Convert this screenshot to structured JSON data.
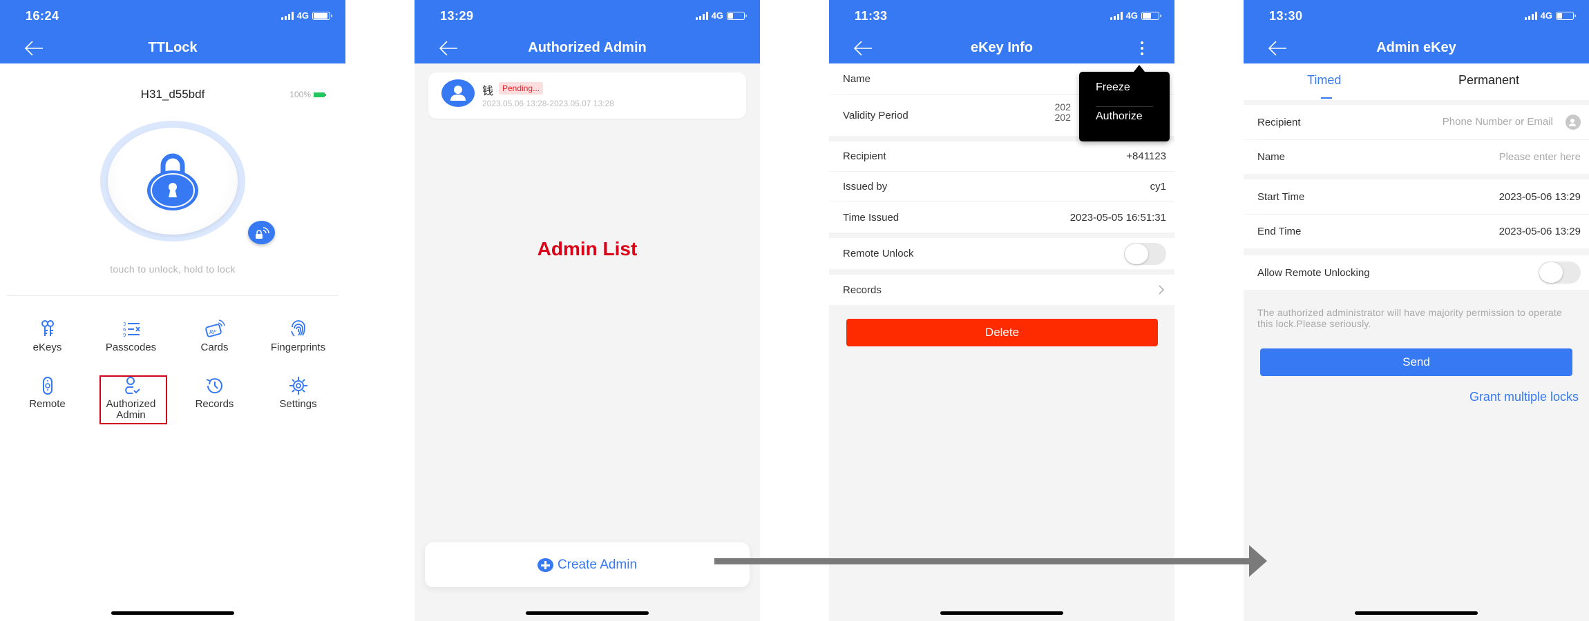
{
  "theme": {
    "primary": "#3679f3",
    "danger": "#fe2a00",
    "annotation": "#d90018",
    "arrow": "#7a7a7a"
  },
  "screen1": {
    "status": {
      "time": "16:24",
      "network": "4G",
      "battery_level": 1.0
    },
    "nav": {
      "title": "TTLock",
      "back_icon": "arrow-left-icon"
    },
    "lock_name": "H31_d55bdf",
    "battery_percent": "100%",
    "hint": "touch to unlock, hold to lock",
    "menu": [
      {
        "label": "eKeys",
        "icon": "ekeys-icon"
      },
      {
        "label": "Passcodes",
        "icon": "passcodes-icon"
      },
      {
        "label": "Cards",
        "icon": "rf-card-icon"
      },
      {
        "label": "Fingerprints",
        "icon": "fingerprint-icon"
      },
      {
        "label": "Remote",
        "icon": "remote-icon"
      },
      {
        "label": "Authorized Admin",
        "label_line1": "Authorized",
        "label_line2": "Admin",
        "icon": "authorized-admin-icon",
        "highlighted": true
      },
      {
        "label": "Records",
        "icon": "history-icon"
      },
      {
        "label": "Settings",
        "icon": "gear-icon"
      }
    ]
  },
  "screen2": {
    "status": {
      "time": "13:29",
      "network": "4G",
      "battery_level": 0.35
    },
    "nav": {
      "title": "Authorized Admin"
    },
    "admins": [
      {
        "name": "钱",
        "status": "Pending...",
        "period": "2023.05.06 13:28-2023.05.07 13:28"
      }
    ],
    "annotation": "Admin List",
    "create_button": "Create Admin"
  },
  "screen3": {
    "status": {
      "time": "11:33",
      "network": "4G",
      "battery_level": 0.6
    },
    "nav": {
      "title": "eKey Info"
    },
    "rows": {
      "name_label": "Name",
      "validity_label": "Validity Period",
      "validity_value_line1": "202",
      "validity_value_line2": "202",
      "recipient_label": "Recipient",
      "recipient_value": "+841123",
      "issued_by_label": "Issued by",
      "issued_by_value": "cy1",
      "time_issued_label": "Time Issued",
      "time_issued_value": "2023-05-05 16:51:31",
      "remote_unlock_label": "Remote Unlock",
      "remote_unlock_on": false,
      "records_label": "Records"
    },
    "popup_menu": [
      "Freeze",
      "Authorize"
    ],
    "delete_button": "Delete"
  },
  "screen4": {
    "status": {
      "time": "13:30",
      "network": "4G",
      "battery_level": 0.35
    },
    "nav": {
      "title": "Admin eKey"
    },
    "tabs": [
      {
        "label": "Timed",
        "active": true
      },
      {
        "label": "Permanent",
        "active": false
      }
    ],
    "form": {
      "recipient_label": "Recipient",
      "recipient_placeholder": "Phone Number or Email",
      "name_label": "Name",
      "name_placeholder": "Please enter here",
      "start_label": "Start Time",
      "start_value": "2023-05-06 13:29",
      "end_label": "End Time",
      "end_value": "2023-05-06 13:29",
      "remote_label": "Allow Remote Unlocking",
      "remote_on": false
    },
    "note": "The authorized administrator will have majority permission to operate this lock.Please seriously.",
    "send_button": "Send",
    "grant_link": "Grant multiple locks"
  }
}
